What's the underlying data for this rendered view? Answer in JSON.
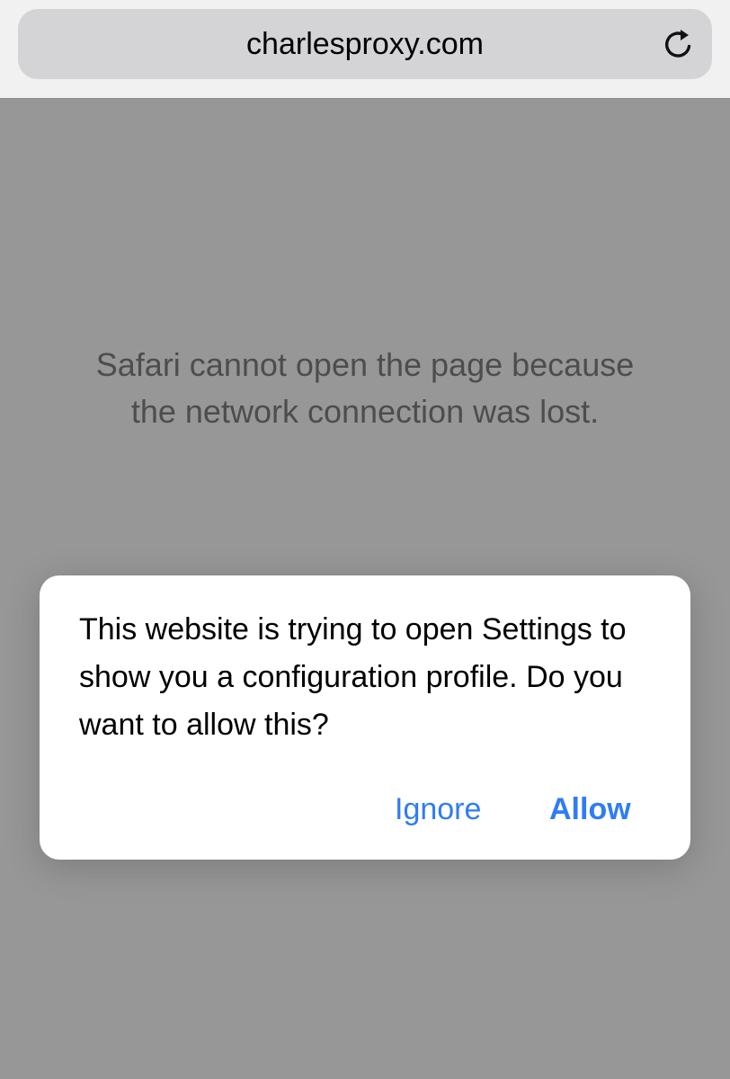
{
  "address_bar": {
    "url": "charlesproxy.com",
    "reload_icon": "reload-icon"
  },
  "page": {
    "error_message": "Safari cannot open the page because the network connection was lost."
  },
  "dialog": {
    "message": "This website is trying to open Settings to show you a configuration profile. Do you want to allow this?",
    "ignore_label": "Ignore",
    "allow_label": "Allow"
  },
  "colors": {
    "accent": "#2f7cf6",
    "page_background": "#979797",
    "toolbar_background": "#f1f1f1",
    "address_bar_background": "#d4d4d6"
  }
}
